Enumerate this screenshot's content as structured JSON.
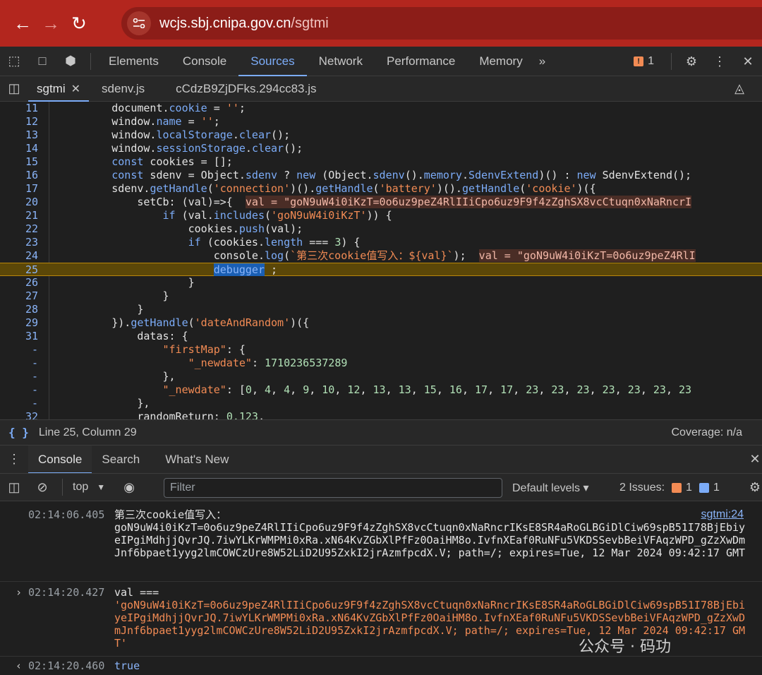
{
  "browser": {
    "url_host": "wcjs.sbj.cnipa.gov.cn",
    "url_path": "/sgtmi"
  },
  "devtools": {
    "tabs": [
      "Elements",
      "Console",
      "Sources",
      "Network",
      "Performance",
      "Memory"
    ],
    "active_tab": "Sources",
    "more": "»",
    "issue_count": "1"
  },
  "sources": {
    "files": [
      "sgtmi",
      "sdenv.js",
      "cCdzB9ZjDFks.294cc83.js"
    ],
    "active_file": "sgtmi"
  },
  "code_lines": [
    {
      "ln": "11",
      "code": "        document.cookie = '';"
    },
    {
      "ln": "12",
      "code": "        window.name = '';"
    },
    {
      "ln": "13",
      "code": "        window.localStorage.clear();"
    },
    {
      "ln": "14",
      "code": "        window.sessionStorage.clear();"
    },
    {
      "ln": "15",
      "code": "        const cookies = [];"
    },
    {
      "ln": "16",
      "code": "        const sdenv = Object.sdenv ? new (Object.sdenv().memory.SdenvExtend)() : new SdenvExtend();"
    },
    {
      "ln": "17",
      "code": "        sdenv.getHandle('connection')().getHandle('battery')().getHandle('cookie')({"
    },
    {
      "ln": "20",
      "code": "            setCb: (val)=>{  "
    },
    {
      "ln": "21",
      "code": "                if (val.includes('goN9uW4i0iKzT')) {"
    },
    {
      "ln": "22",
      "code": "                    cookies.push(val);"
    },
    {
      "ln": "23",
      "code": "                    if (cookies.length === 3) {"
    },
    {
      "ln": "24",
      "code": "                        console.log(`第三次cookie值写入：${val}`);  "
    },
    {
      "ln": "25",
      "code": "                        debugger ;"
    },
    {
      "ln": "26",
      "code": "                    }"
    },
    {
      "ln": "27",
      "code": "                }"
    },
    {
      "ln": "28",
      "code": "            }"
    },
    {
      "ln": "29",
      "code": "        }).getHandle('dateAndRandom')({"
    },
    {
      "ln": "31",
      "code": "            datas: {"
    },
    {
      "ln": "-",
      "code": "                \"firstMap\": {"
    },
    {
      "ln": "-",
      "code": "                    \"_newdate\": 1710236537289"
    },
    {
      "ln": "-",
      "code": "                },"
    },
    {
      "ln": "-",
      "code": "                \"_newdate\": [0, 4, 4, 9, 10, 12, 13, 13, 15, 16, 17, 17, 23, 23, 23, 23, 23, 23, 23"
    },
    {
      "ln": "-",
      "code": "            },"
    },
    {
      "ln": "32",
      "code": "            randomReturn: 0.123,"
    }
  ],
  "inline_values": {
    "line20": "val = \"goN9uW4i0iKzT=0o6uz9peZ4RlIIiCpo6uz9F9f4zZghSX8vcCtuqn0xNaRncrI",
    "line24": "val = \"goN9uW4i0iKzT=0o6uz9peZ4RlI"
  },
  "status": {
    "position": "Line 25, Column 29",
    "coverage": "Coverage: n/a"
  },
  "drawer": {
    "tabs": [
      "Console",
      "Search",
      "What's New"
    ],
    "active": "Console"
  },
  "console_toolbar": {
    "context": "top",
    "filter_placeholder": "Filter",
    "levels": "Default levels ▾",
    "issues_label": "2 Issues:",
    "issue_warn": "1",
    "issue_info": "1"
  },
  "messages": [
    {
      "ts": "02:14:06.405",
      "text": "第三次cookie值写入：\ngoN9uW4i0iKzT=0o6uz9peZ4RlIIiCpo6uz9F9f4zZghSX8vcCtuqn0xNaRncrIKsE8SR4aRoGLBGiDlCiw69spB51I78BjEbiyeIPgiMdhjjQvrJQ.7iwYLKrWMPMi0xRa.xN64KvZGbXlPfFz0OaiHM8o.IvfnXEaf0RuNFu5VKDSSevbBeiVFAqzWPD_gZzXwDmJnf6bpaet1yyg2lmCOWCzUre8W52LiD2U95ZxkI2jrAzmfpcdX.V; path=/; expires=Tue, 12 Mar 2024 09:42:17 GMT",
      "source": "sgtmi:24"
    },
    {
      "ts": "02:14:20.427",
      "label": "val ===",
      "text": "'goN9uW4i0iKzT=0o6uz9peZ4RlIIiCpo6uz9F9f4zZghSX8vcCtuqn0xNaRncrIKsE8SR4aRoGLBGiDlCiw69spB51I78BjEbiyeIPgiMdhjjQvrJQ.7iwYLKrWMPMi0xRa.xN64KvZGbXlPfFz0OaiHM8o.IvfnXEaf0RuNFu5VKDSSevbBeiVFAqzWPD_gZzXwDmJnf6bpaet1yyg2lmCOWCzUre8W52LiD2U95ZxkI2jrAzmfpcdX.V; path=/; expires=Tue, 12 Mar 2024 09:42:17 GMT'"
    },
    {
      "ts": "02:14:20.460",
      "text": "true"
    }
  ],
  "watermark": "公众号 · 码功",
  "colors": {
    "address_bar": "#b3261e",
    "accent": "#7cacf8",
    "string": "#f28b54",
    "breakpoint_line": "#5b4708"
  }
}
